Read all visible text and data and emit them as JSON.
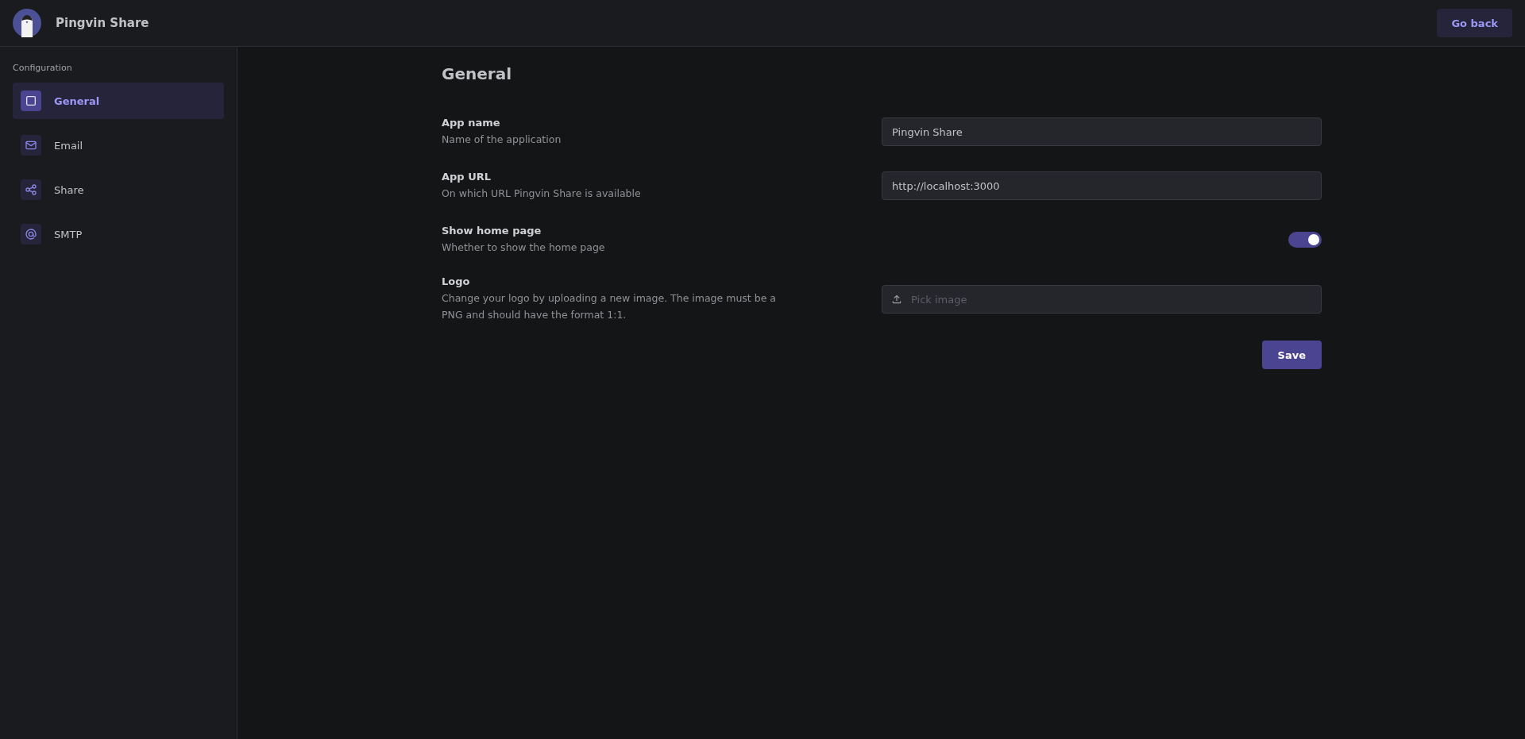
{
  "header": {
    "app_name": "Pingvin Share",
    "back_button": "Go back"
  },
  "sidebar": {
    "heading": "Configuration",
    "items": [
      {
        "label": "General",
        "selected": true
      },
      {
        "label": "Email",
        "selected": false
      },
      {
        "label": "Share",
        "selected": false
      },
      {
        "label": "SMTP",
        "selected": false
      }
    ]
  },
  "section": {
    "title": "General",
    "settings": [
      {
        "kind": "text",
        "label": "App name",
        "description": "Name of the application",
        "value": "Pingvin Share"
      },
      {
        "kind": "text",
        "label": "App URL",
        "description": "On which URL Pingvin Share is available",
        "value": "http://localhost:3000"
      },
      {
        "kind": "switch",
        "label": "Show home page",
        "description": "Whether to show the home page",
        "on": true
      },
      {
        "kind": "file",
        "label": "Logo",
        "description": "Change your logo by uploading a new image. The image must be a PNG and should have the format 1:1.",
        "placeholder": "Pick image"
      }
    ],
    "save_button": "Save"
  }
}
